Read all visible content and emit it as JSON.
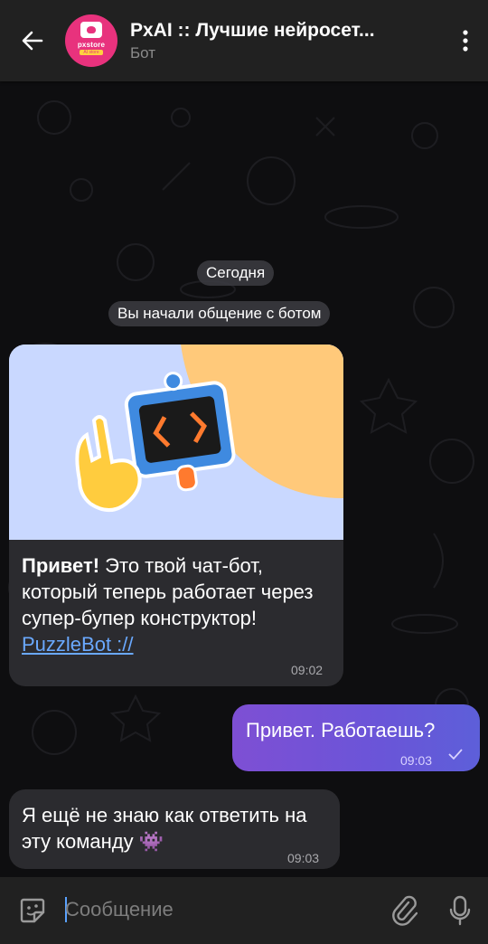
{
  "header": {
    "title": "PxAI :: Лучшие нейросет...",
    "subtitle": "Бот",
    "avatar": {
      "logo_text": "pxstore",
      "logo_sub": "AI store"
    },
    "accent_color": "#e8327d"
  },
  "chat": {
    "date_label": "Сегодня",
    "service_message": "Вы начали общение с ботом",
    "messages": [
      {
        "direction": "incoming",
        "bold_text": "Привет!",
        "text": " Это твой чат-бот, который теперь работает через супер-бупер конструктор! ",
        "link_text": "PuzzleBot ://",
        "time": "09:02"
      },
      {
        "direction": "outgoing",
        "text": "Привет. Работаешь?",
        "time": "09:03",
        "status_icon": "check-icon"
      },
      {
        "direction": "incoming",
        "text": "Я ещё не знаю как ответить на эту команду 👾",
        "time": "09:03"
      }
    ]
  },
  "input": {
    "placeholder": "Сообщение"
  },
  "colors": {
    "outgoing_bubble": "#7e4fd4",
    "incoming_bubble": "#2b2b2f",
    "link": "#6aa9ff"
  }
}
